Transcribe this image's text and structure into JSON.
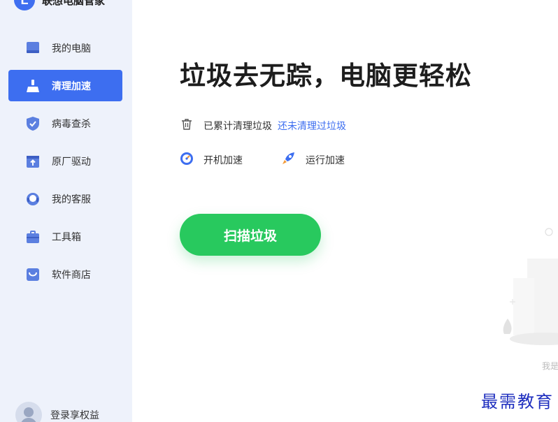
{
  "app": {
    "name": "联想电脑管家",
    "logo_letter": "L"
  },
  "sidebar": {
    "items": [
      {
        "label": "我的电脑",
        "icon": "laptop-icon",
        "active": false
      },
      {
        "label": "清理加速",
        "icon": "broom-icon",
        "active": true
      },
      {
        "label": "病毒查杀",
        "icon": "shield-icon",
        "active": false
      },
      {
        "label": "原厂驱动",
        "icon": "driver-upload-icon",
        "active": false
      },
      {
        "label": "我的客服",
        "icon": "headset-icon",
        "active": false
      },
      {
        "label": "工具箱",
        "icon": "toolbox-icon",
        "active": false
      },
      {
        "label": "软件商店",
        "icon": "shopping-bag-icon",
        "active": false
      }
    ],
    "login_label": "登录享权益"
  },
  "main": {
    "headline": "垃圾去无踪，电脑更轻松",
    "stat": {
      "label": "已累计清理垃圾",
      "link": "还未清理过垃圾"
    },
    "features": [
      {
        "label": "开机加速",
        "icon": "speedometer-icon"
      },
      {
        "label": "运行加速",
        "icon": "rocket-icon"
      }
    ],
    "scan_button": "扫描垃圾",
    "peek_text": "我是"
  },
  "watermark": "最需教育",
  "colors": {
    "accent": "#3d6ef0",
    "scan_green": "#28c95e",
    "sidebar_bg": "#eef2fb"
  }
}
